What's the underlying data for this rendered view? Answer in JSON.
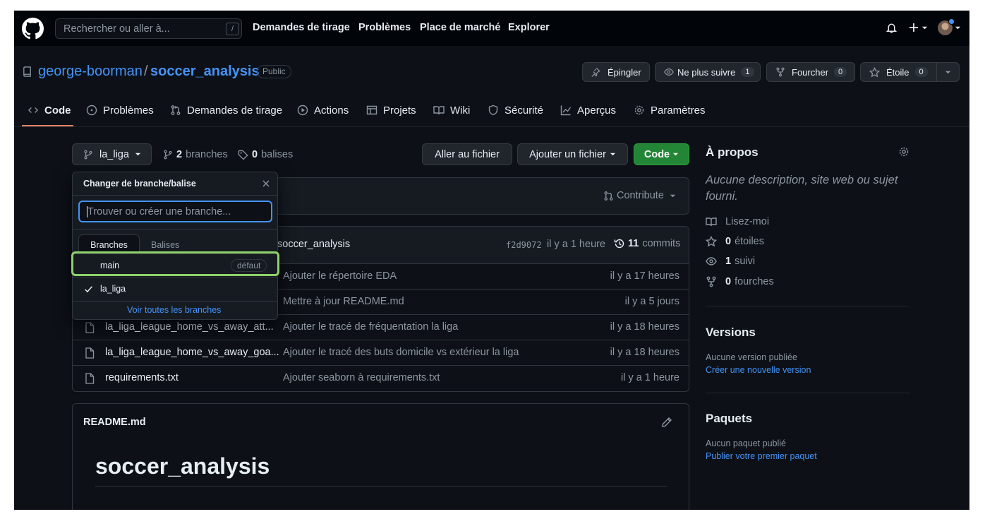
{
  "topbar": {
    "search_placeholder": "Rechercher ou aller à...",
    "search_shortcut": "/",
    "nav": [
      "Demandes de tirage",
      "Problèmes",
      "Place de marché",
      "Explorer"
    ]
  },
  "repo": {
    "owner": "george-boorman",
    "separator": "/",
    "name": "soccer_analysis",
    "visibility": "Public",
    "pin_label": "Épingler",
    "watch_label": "Ne plus suivre",
    "watch_count": "1",
    "fork_label": "Fourcher",
    "fork_count": "0",
    "star_label": "Étoile",
    "star_count": "0"
  },
  "tabs": [
    "Code",
    "Problèmes",
    "Demandes de tirage",
    "Actions",
    "Projets",
    "Wiki",
    "Sécurité",
    "Aperçus",
    "Paramètres"
  ],
  "branchbar": {
    "current_branch": "la_liga",
    "branches_count": "2",
    "branches_label": "branches",
    "tags_count": "0",
    "tags_label": "balises",
    "goto_file": "Aller au fichier",
    "add_file": "Ajouter un fichier",
    "code": "Code",
    "contribute": "Contribute"
  },
  "commit_header": {
    "message": "soccer_analysis",
    "sha": "f2d9072",
    "time": "il y a 1 heure",
    "commits_count": "11",
    "commits_label": "commits"
  },
  "files": [
    {
      "name": "",
      "message": "Ajouter le répertoire EDA",
      "time": "il y a 17 heures"
    },
    {
      "name": "",
      "message": "Mettre à jour README.md",
      "time": "il y a 5 jours"
    },
    {
      "name": "la_liga_league_home_vs_away_att...",
      "message": "Ajouter le tracé de fréquentation la liga",
      "time": "il y a 18 heures"
    },
    {
      "name": "la_liga_league_home_vs_away_goa...",
      "message": "Ajouter le tracé des buts domicile vs extérieur la liga",
      "time": "il y a 18 heures"
    },
    {
      "name": "requirements.txt",
      "message": "Ajouter seaborn à requirements.txt",
      "time": "il y a 1 heure"
    }
  ],
  "readme": {
    "filename": "README.md",
    "heading": "soccer_analysis"
  },
  "dropdown": {
    "title": "Changer de branche/balise",
    "search_placeholder": "Trouver ou créer une branche...",
    "tab_branches": "Branches",
    "tab_tags": "Balises",
    "items": [
      {
        "name": "main",
        "badge": "défaut"
      },
      {
        "name": "la_liga",
        "badge": ""
      }
    ],
    "view_all": "Voir toutes les branches"
  },
  "about": {
    "title": "À propos",
    "description": "Aucune description, site web ou sujet fourni.",
    "readme": "Lisez-moi",
    "stars_count": "0",
    "stars_label": "étoiles",
    "watching_count": "1",
    "watching_label": "suivi",
    "forks_count": "0",
    "forks_label": "fourches"
  },
  "releases": {
    "title": "Versions",
    "none": "Aucune version publiée",
    "create": "Créer une nouvelle version"
  },
  "packages": {
    "title": "Paquets",
    "none": "Aucun paquet publié",
    "publish": "Publier votre premier paquet"
  },
  "colors": {
    "background": "#0d1117",
    "header": "#010409",
    "link": "#4493f8",
    "green_button": "#238636",
    "tab_underline": "#f78166",
    "highlight_outline": "#8fd16a"
  }
}
